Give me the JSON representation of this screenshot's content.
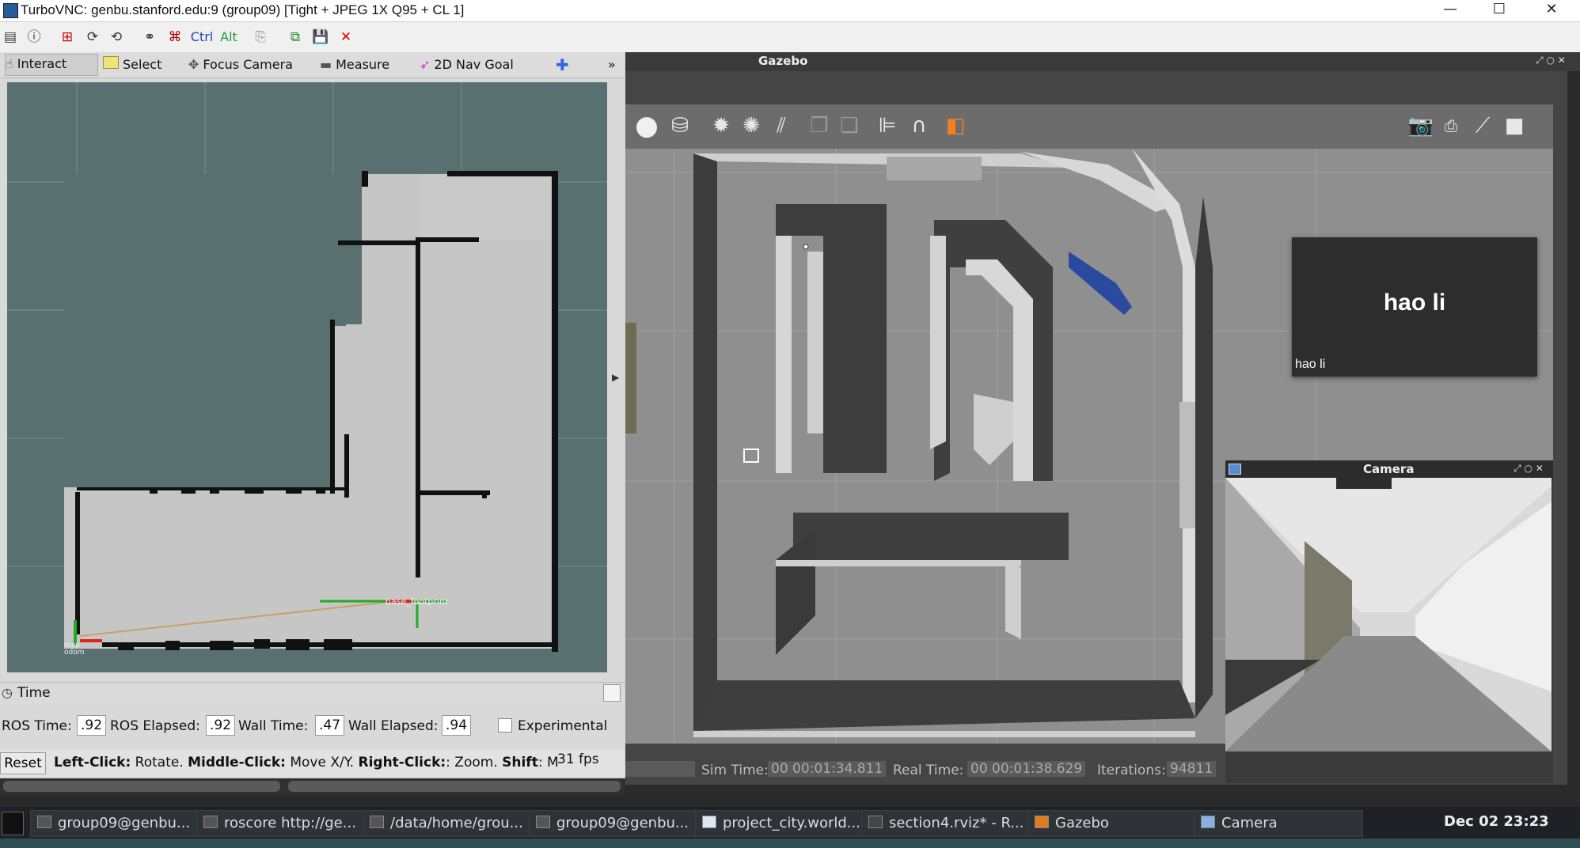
{
  "window": {
    "title": "TurboVNC: genbu.stanford.edu:9 (group09) [Tight + JPEG 1X Q95 + CL 1]",
    "minimize": "—",
    "maximize": "☐",
    "close": "✕"
  },
  "vnc_toolbar": {
    "ctrl_label": "Ctrl",
    "alt_label": "Alt"
  },
  "rviz": {
    "tools": {
      "interact": "Interact",
      "select": "Select",
      "focus_camera": "Focus Camera",
      "measure": "Measure",
      "nav_goal": "2D Nav Goal",
      "more": "»"
    },
    "map_labels": {
      "base_footprint": "base_footprint",
      "odom": "map\nodom"
    },
    "time_panel": {
      "title": "Time",
      "ros_time_label": "ROS Time:",
      "ros_time_value": ".92",
      "ros_elapsed_label": "ROS Elapsed:",
      "ros_elapsed_value": ".92",
      "wall_time_label": "Wall Time:",
      "wall_time_value": ".47",
      "wall_elapsed_label": "Wall Elapsed:",
      "wall_elapsed_value": ".94",
      "experimental_label": "Experimental"
    },
    "status": {
      "reset_label": "Reset",
      "left_click": "Left-Click:",
      "rotate": " Rotate. ",
      "middle_click": "Middle-Click:",
      "move": " Move X/Y. ",
      "right_click": "Right-Click:",
      "zoom": ": Zoom. ",
      "shift": "Shift",
      "shift_rest": ": M",
      "fps": "31 fps"
    }
  },
  "gazebo": {
    "title": "Gazebo",
    "status": {
      "sim_time_label": "Sim Time:",
      "sim_time_value": "00 00:01:34.811",
      "real_time_label": "Real Time:",
      "real_time_value": "00 00:01:38.629",
      "iterations_label": "Iterations:",
      "iterations_value": "94811"
    }
  },
  "overlay": {
    "name_big": "hao li",
    "name_small": "hao li"
  },
  "camera_window": {
    "title": "Camera"
  },
  "taskbar": {
    "items": [
      "group09@genbu...",
      "roscore http://ge...",
      "/data/home/grou...",
      "group09@genbu...",
      "project_city.world...",
      "section4.rviz* - R...",
      "Gazebo",
      "Camera"
    ],
    "clock": "Dec 02 23:23"
  }
}
